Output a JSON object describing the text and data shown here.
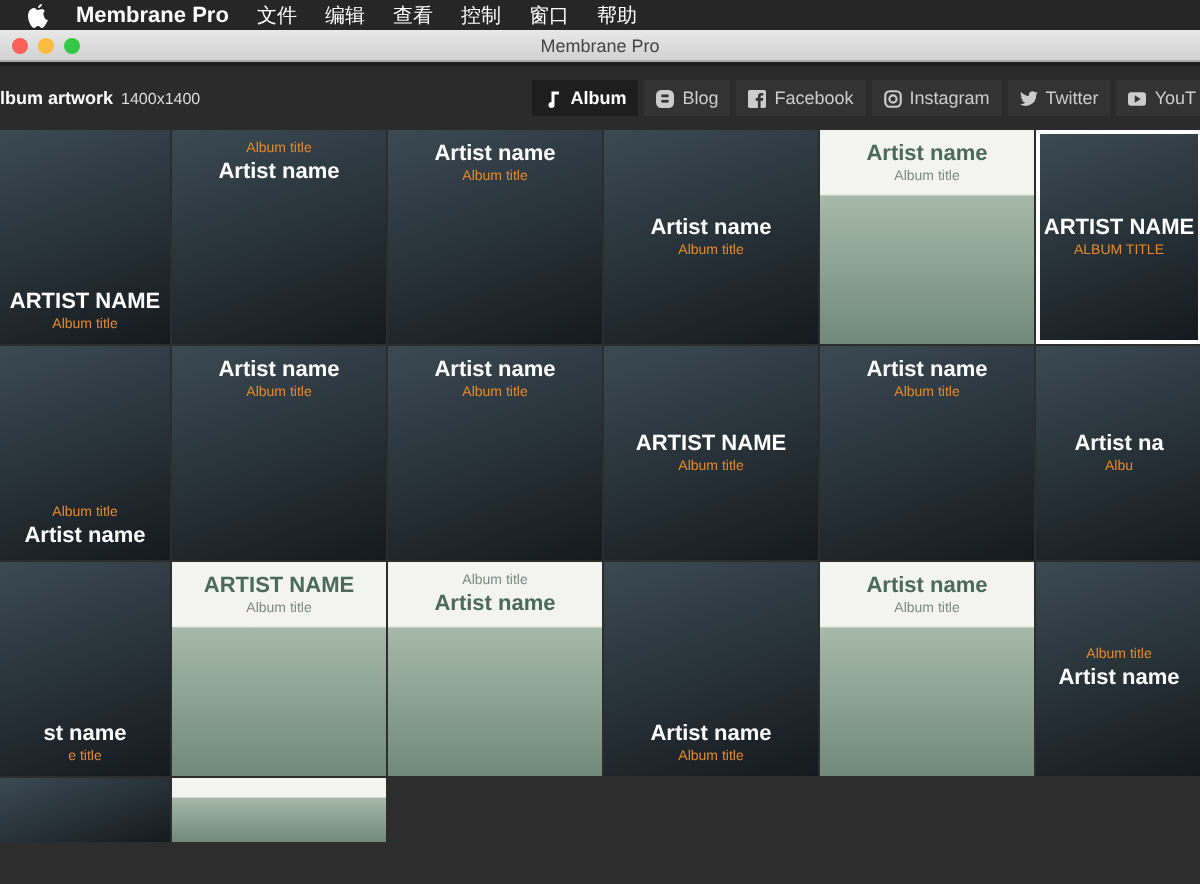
{
  "menu_bar": {
    "app": "Membrane Pro",
    "items": [
      "文件",
      "编辑",
      "查看",
      "控制",
      "窗口",
      "帮助"
    ]
  },
  "window": {
    "title": "Membrane Pro"
  },
  "header": {
    "title": "lbum artwork",
    "size": "1400x1400"
  },
  "tabs": [
    {
      "label": "Album",
      "selected": true
    },
    {
      "label": "Blog",
      "selected": false
    },
    {
      "label": "Facebook",
      "selected": false
    },
    {
      "label": "Instagram",
      "selected": false
    },
    {
      "label": "Twitter",
      "selected": false
    },
    {
      "label": "YouT",
      "selected": false
    }
  ],
  "tiles": [
    {
      "artist": "ARTIST NAME",
      "album": "Album title",
      "kind": "bottom",
      "album_first": false,
      "selected": false,
      "cut": false
    },
    {
      "artist": "Artist name",
      "album": "Album title",
      "kind": "top",
      "album_first": true,
      "selected": false,
      "cut": false
    },
    {
      "artist": "Artist name",
      "album": "Album title",
      "kind": "top",
      "album_first": false,
      "selected": false,
      "cut": false
    },
    {
      "artist": "Artist name",
      "album": "Album title",
      "kind": "center",
      "album_first": false,
      "selected": false,
      "cut": false
    },
    {
      "artist": "Artist name",
      "album": "Album title",
      "kind": "banner",
      "album_first": false,
      "selected": false,
      "cut": false
    },
    {
      "artist": "ARTIST NAME",
      "album": "ALBUM TITLE",
      "kind": "center",
      "album_first": false,
      "selected": true,
      "cut": false
    },
    {
      "artist": "Artist name",
      "album": "Album title",
      "kind": "bottom",
      "album_first": true,
      "selected": false,
      "cut": false
    },
    {
      "artist": "Artist name",
      "album": "Album title",
      "kind": "top",
      "album_first": false,
      "selected": false,
      "cut": false
    },
    {
      "artist": "Artist name",
      "album": "Album title",
      "kind": "top",
      "album_first": false,
      "selected": false,
      "cut": false
    },
    {
      "artist": "ARTIST NAME",
      "album": "Album title",
      "kind": "center",
      "album_first": false,
      "selected": false,
      "cut": false
    },
    {
      "artist": "Artist name",
      "album": "Album title",
      "kind": "top",
      "album_first": false,
      "selected": false,
      "cut": false
    },
    {
      "artist": "Artist na",
      "album": "Albu",
      "kind": "center",
      "album_first": false,
      "selected": false,
      "cut": false
    },
    {
      "artist": "st name",
      "album": "e title",
      "kind": "bottom",
      "album_first": false,
      "selected": false,
      "cut": false
    },
    {
      "artist": "ARTIST NAME",
      "album": "Album title",
      "kind": "banner",
      "album_first": false,
      "selected": false,
      "cut": false
    },
    {
      "artist": "Artist name",
      "album": "Album title",
      "kind": "banner",
      "album_first": true,
      "selected": false,
      "cut": false
    },
    {
      "artist": "Artist name",
      "album": "Album title",
      "kind": "bottom",
      "album_first": false,
      "selected": false,
      "cut": false
    },
    {
      "artist": "Artist name",
      "album": "Album title",
      "kind": "banner",
      "album_first": false,
      "selected": false,
      "cut": false
    },
    {
      "artist": "Artist name",
      "album": "Album title",
      "kind": "center",
      "album_first": true,
      "selected": false,
      "cut": false
    },
    {
      "kind": "top",
      "selected": false,
      "cut": true
    },
    {
      "kind": "banner",
      "selected": false,
      "cut": true
    }
  ]
}
